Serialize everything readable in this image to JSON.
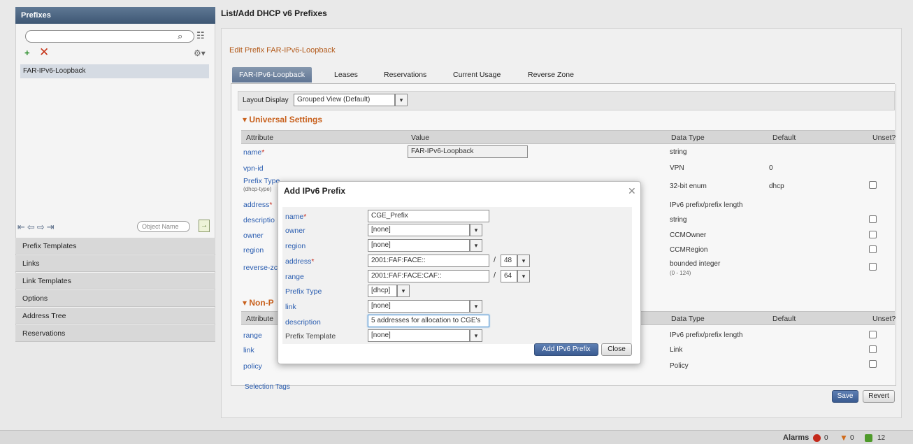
{
  "left": {
    "title": "Prefixes",
    "search_icon": "magnifier-icon",
    "tree_icon": "tree-icon",
    "add_icon": "add-icon",
    "delete_icon": "delete-x-icon",
    "settings_icon": "settings-icon",
    "list_items": [
      "FAR-IPv6-Loopback"
    ],
    "object_name_placeholder": "Object Name",
    "nav_items": [
      "Prefix Templates",
      "Links",
      "Link Templates",
      "Options",
      "Address Tree",
      "Reservations"
    ]
  },
  "main": {
    "page_title": "List/Add DHCP v6 Prefixes",
    "edit_title": "Edit Prefix FAR-IPv6-Loopback",
    "tabs": [
      "FAR-IPv6-Loopback",
      "Leases",
      "Reservations",
      "Current Usage",
      "Reverse Zone"
    ],
    "layout_label": "Layout Display",
    "layout_value": "Grouped View (Default)",
    "section1_title": "Universal Settings",
    "section2_title": "Non-P",
    "headers": {
      "attribute": "Attribute",
      "value": "Value",
      "data_type": "Data Type",
      "default": "Default",
      "unset": "Unset?"
    },
    "headers2": {
      "attribute": "Attribute",
      "data_type": "Data Type",
      "default": "Default",
      "unset": "Unset?"
    },
    "rows1": [
      {
        "attr": "name",
        "required": true,
        "value": "FAR-IPv6-Loopback",
        "type": "string",
        "default": "",
        "unset": false
      },
      {
        "attr": "vpn-id",
        "required": false,
        "type": "VPN",
        "default": "0",
        "unset": false
      },
      {
        "attr": "Prefix Type",
        "sub": "(dhcp-type)",
        "required": false,
        "type": "32-bit enum",
        "default": "dhcp",
        "unset": true
      },
      {
        "attr": "address",
        "required": true,
        "type": "IPv6 prefix/prefix length",
        "default": "",
        "unset": false
      },
      {
        "attr": "descriptio",
        "required": false,
        "type": "string",
        "default": "",
        "unset": true
      },
      {
        "attr": "owner",
        "required": false,
        "type": "CCMOwner",
        "default": "",
        "unset": true
      },
      {
        "attr": "region",
        "required": false,
        "type": "CCMRegion",
        "default": "",
        "unset": true
      },
      {
        "attr": "reverse-zc",
        "required": false,
        "type": "bounded integer",
        "type_sub": "(0 - 124)",
        "default": "",
        "unset": true
      }
    ],
    "rows2": [
      {
        "attr": "range",
        "type": "IPv6 prefix/prefix length",
        "unset": true
      },
      {
        "attr": "link",
        "type": "Link",
        "unset": true
      },
      {
        "attr": "policy",
        "type": "Policy",
        "unset": true
      }
    ],
    "selection_text": "Selection Tags",
    "save_label": "Save",
    "revert_label": "Revert"
  },
  "modal": {
    "title": "Add IPv6 Prefix",
    "close_icon": "close-icon",
    "fields": {
      "name": {
        "label": "name",
        "value": "CGE_Prefix"
      },
      "owner": {
        "label": "owner",
        "value": "[none]"
      },
      "region": {
        "label": "region",
        "value": "[none]"
      },
      "address": {
        "label": "address",
        "value": "2001:FAF:FACE::",
        "prefix_len": "48"
      },
      "range": {
        "label": "range",
        "value": "2001:FAF:FACE:CAF::",
        "prefix_len": "64"
      },
      "prefix_type": {
        "label": "Prefix Type",
        "value": "[dhcp]"
      },
      "link": {
        "label": "link",
        "value": "[none]"
      },
      "description": {
        "label": "description",
        "value": "5 addresses for allocation to CGE's"
      },
      "prefix_template": {
        "label": "Prefix Template",
        "value": "[none]"
      }
    },
    "add_label": "Add IPv6 Prefix",
    "close_label": "Close"
  },
  "footer": {
    "alarms_label": "Alarms",
    "critical": "0",
    "warning": "0",
    "ok": "12"
  },
  "colors": {
    "header_blue": "#4a6484",
    "accent_orange": "#c8601c",
    "link_blue": "#2a5db0",
    "primary_button": "#3a5b91"
  }
}
